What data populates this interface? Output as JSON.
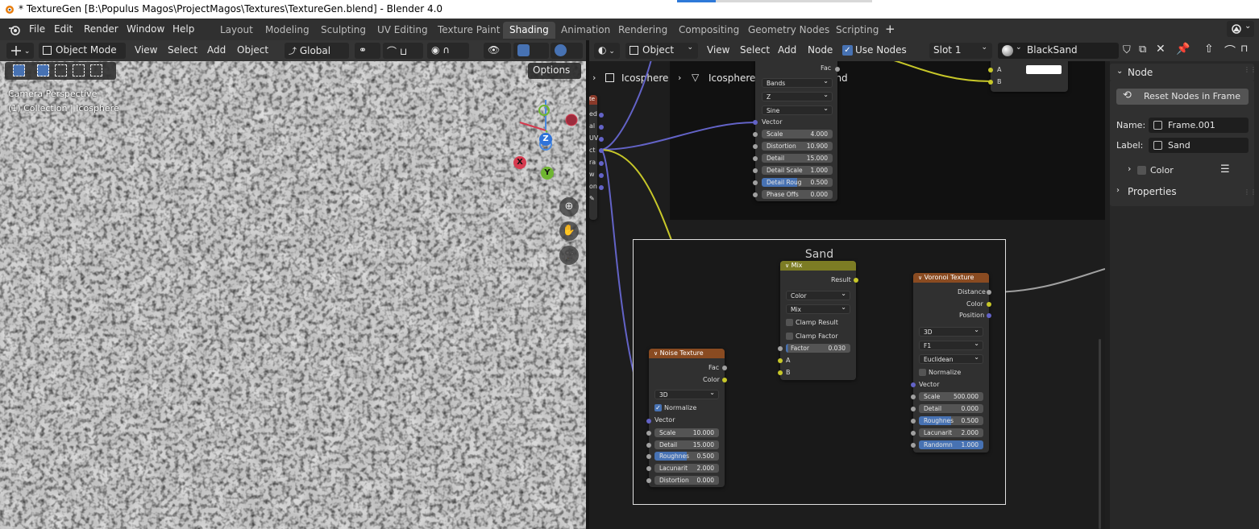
{
  "title_bar": {
    "text": "* TextureGen [B:\\Populus Magos\\ProjectMagos\\Textures\\TextureGen.blend] - Blender 4.0"
  },
  "menu": {
    "file": "File",
    "edit": "Edit",
    "render": "Render",
    "window": "Window",
    "help": "Help"
  },
  "workspaces": [
    {
      "label": "Layout"
    },
    {
      "label": "Modeling"
    },
    {
      "label": "Sculpting"
    },
    {
      "label": "UV Editing"
    },
    {
      "label": "Texture Paint"
    },
    {
      "label": "Shading"
    },
    {
      "label": "Animation"
    },
    {
      "label": "Rendering"
    },
    {
      "label": "Compositing"
    },
    {
      "label": "Geometry Nodes"
    },
    {
      "label": "Scripting"
    }
  ],
  "add_workspace": "+",
  "viewport": {
    "mode": "Object Mode",
    "view": "View",
    "select": "Select",
    "add": "Add",
    "object": "Object",
    "orientation": "Global",
    "options": "Options",
    "camera_label": "Camera Perspective",
    "collection_label": "(1) Collection | Icosphere",
    "gizmo": {
      "z": "Z",
      "x": "X",
      "y": "Y"
    }
  },
  "node_editor": {
    "object_dd": "Object",
    "view": "View",
    "select": "Select",
    "add": "Add",
    "node": "Node",
    "use_nodes": "Use Nodes",
    "slot": "Slot 1",
    "material": "BlackSand",
    "breadcrumb": [
      "Icosphere",
      "Icosphere",
      "BlackSand"
    ]
  },
  "upper_wave_node": {
    "fac": "Fac",
    "bands": "Bands",
    "z": "Z",
    "sine": "Sine",
    "vector": "Vector",
    "fields": [
      {
        "label": "Scale",
        "value": "4.000"
      },
      {
        "label": "Distortion",
        "value": "10.900"
      },
      {
        "label": "Detail",
        "value": "15.000"
      },
      {
        "label": "Detail Scale",
        "value": "1.000"
      },
      {
        "label": "Detail Roug",
        "value": "0.500"
      },
      {
        "label": "Phase Offs",
        "value": "0.000"
      }
    ]
  },
  "left_partial_node": {
    "header": "te",
    "outputs": [
      "ed",
      "al",
      "UV",
      "ct",
      "ra",
      "w",
      "on"
    ]
  },
  "upper_right_node": {
    "a": "A",
    "b": "B"
  },
  "frame": {
    "label": "Sand"
  },
  "mix_node": {
    "title": "Mix",
    "result": "Result",
    "data_type": "Color",
    "blend": "Mix",
    "clamp_result": "Clamp Result",
    "clamp_factor": "Clamp Factor",
    "factor_label": "Factor",
    "factor_value": "0.030",
    "a": "A",
    "b": "B"
  },
  "noise_node": {
    "title": "Noise Texture",
    "fac": "Fac",
    "color": "Color",
    "dimensions": "3D",
    "normalize": "Normalize",
    "vector": "Vector",
    "fields": [
      {
        "label": "Scale",
        "value": "10.000"
      },
      {
        "label": "Detail",
        "value": "15.000"
      },
      {
        "label": "Roughnes",
        "value": "0.500"
      },
      {
        "label": "Lacunarit",
        "value": "2.000"
      },
      {
        "label": "Distortion",
        "value": "0.000"
      }
    ]
  },
  "voronoi_node": {
    "title": "Voronoi Texture",
    "distance": "Distance",
    "color": "Color",
    "position": "Position",
    "dimensions": "3D",
    "feature": "F1",
    "metric": "Euclidean",
    "normalize": "Normalize",
    "vector": "Vector",
    "fields": [
      {
        "label": "Scale",
        "value": "500.000"
      },
      {
        "label": "Detail",
        "value": "0.000"
      },
      {
        "label": "Roughnes",
        "value": "0.500"
      },
      {
        "label": "Lacunarit",
        "value": "2.000"
      },
      {
        "label": "Randomn",
        "value": "1.000"
      }
    ]
  },
  "sidebar": {
    "node_panel": "Node",
    "reset_btn": "Reset Nodes in Frame",
    "name_label": "Name:",
    "name_value": "Frame.001",
    "label_label": "Label:",
    "label_value": "Sand",
    "color_panel": "Color",
    "properties_panel": "Properties"
  },
  "colors": {
    "accent": "#4772b3",
    "texture_header": "#8a4b21",
    "mix_header": "#7c7c24",
    "socket_yellow": "#c7c729",
    "socket_purple": "#6363c7",
    "socket_grey": "#a1a1a1"
  }
}
